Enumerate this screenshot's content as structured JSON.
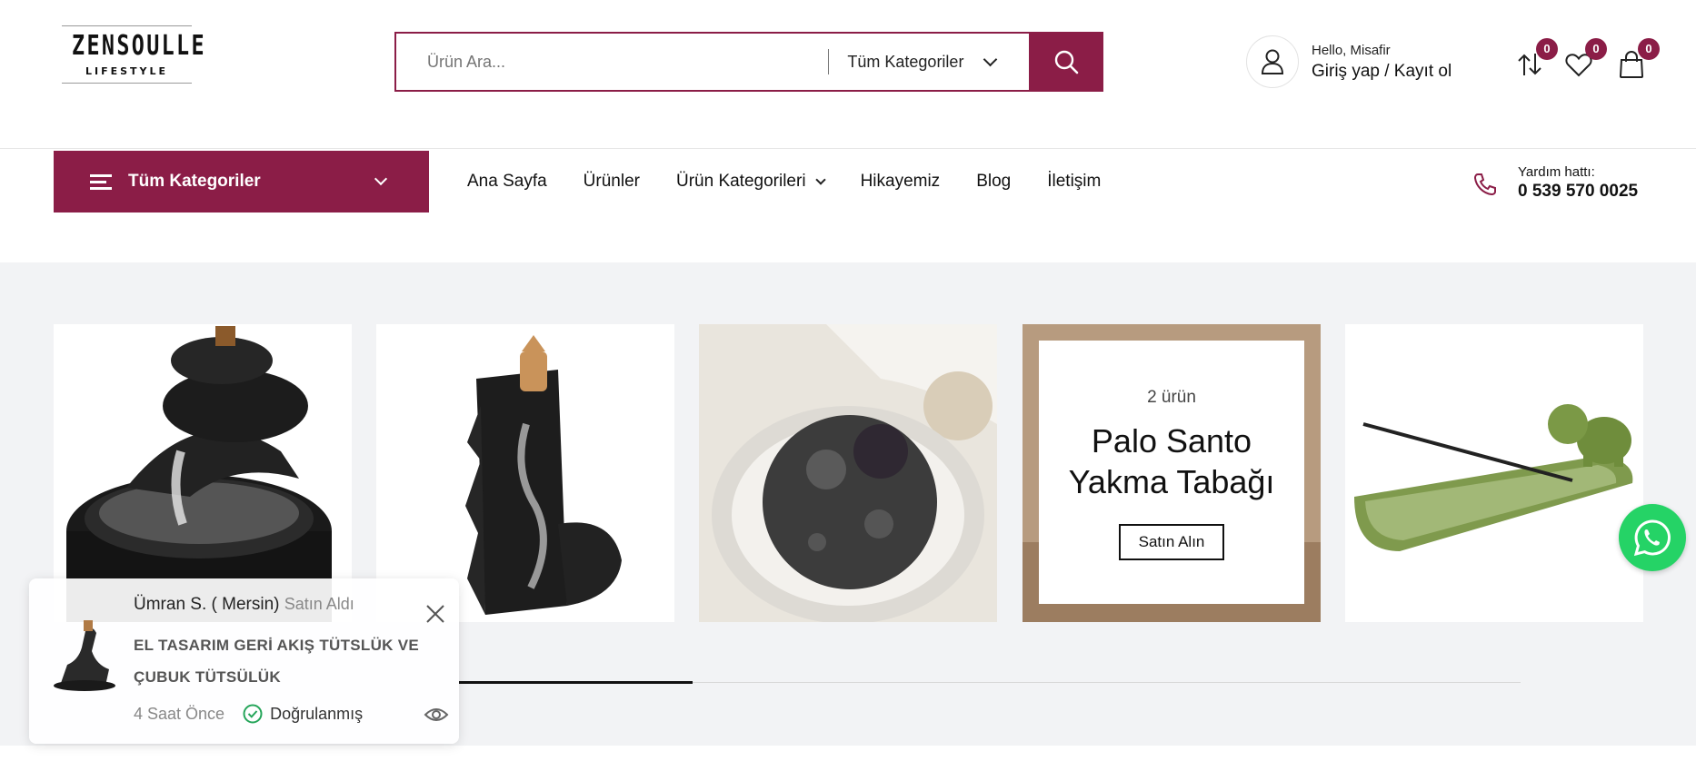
{
  "brand": {
    "name": "ZENSOULLE",
    "tagline": "LIFESTYLE"
  },
  "search": {
    "placeholder": "Ürün Ara...",
    "category": "Tüm Kategoriler"
  },
  "account": {
    "greeting": "Hello, Misafir",
    "login": "Giriş yap / Kayıt ol"
  },
  "header_icons": {
    "compare_count": "0",
    "wishlist_count": "0",
    "cart_count": "0"
  },
  "nav": {
    "all_categories": "Tüm Kategoriler",
    "items": [
      "Ana Sayfa",
      "Ürünler",
      "Ürün Kategorileri",
      "Hikayemiz",
      "Blog",
      "İletişim"
    ]
  },
  "helpline": {
    "label": "Yardım hattı:",
    "phone": "0 539 570 0025"
  },
  "promo": {
    "count": "2 ürün",
    "title": "Palo Santo Yakma Tabağı",
    "button": "Satın Alın"
  },
  "slider": {
    "progress": 0.22
  },
  "popup": {
    "buyer": "Ümran S. ( Mersin)",
    "action": "Satın Aldı",
    "product": "EL TASARIM GERİ AKIŞ TÜTSLÜK VE ÇUBUK TÜTSÜLÜK",
    "time": "4 Saat Önce",
    "verified": "Doğrulanmış"
  },
  "colors": {
    "accent": "#8b1d47",
    "whatsapp": "#25d366",
    "gallery_bg": "#f2f3f5"
  }
}
